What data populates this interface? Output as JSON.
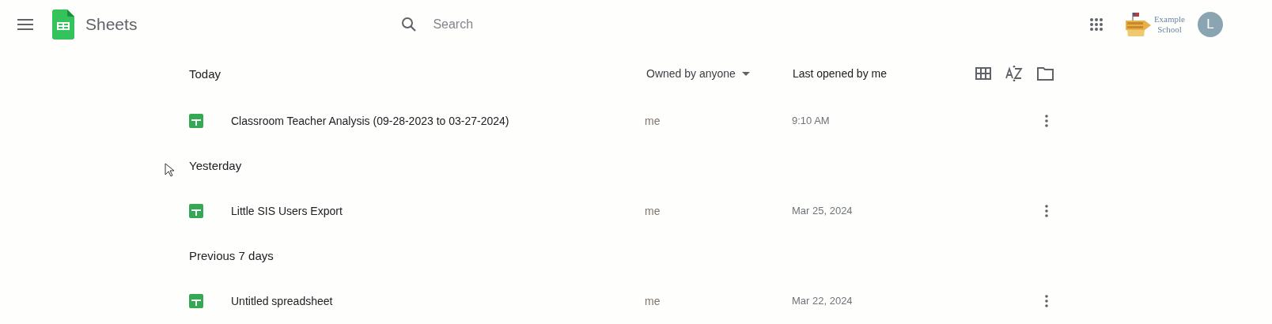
{
  "app_bar": {
    "title": "Sheets",
    "search": {
      "placeholder": "Search"
    },
    "logo": {
      "line_1": "Example",
      "line_2": "School"
    },
    "avatar": "L"
  },
  "list_header": {
    "owner_filter": "Owned by anyone",
    "sort": "Last opened by me"
  },
  "groups": [
    {
      "title": "Today",
      "files": [
        {
          "name": "Classroom Teacher Analysis (09-28-2023 to 03-27-2024)",
          "owner": "me",
          "opened": "9:10 AM"
        }
      ]
    },
    {
      "title": "Yesterday",
      "files": [
        {
          "name": "Little SIS Users Export",
          "owner": "me",
          "opened": "Mar 25, 2024"
        }
      ]
    },
    {
      "title": "Previous 7 days",
      "files": [
        {
          "name": "Untitled spreadsheet",
          "owner": "me",
          "opened": "Mar 22, 2024"
        }
      ]
    }
  ]
}
